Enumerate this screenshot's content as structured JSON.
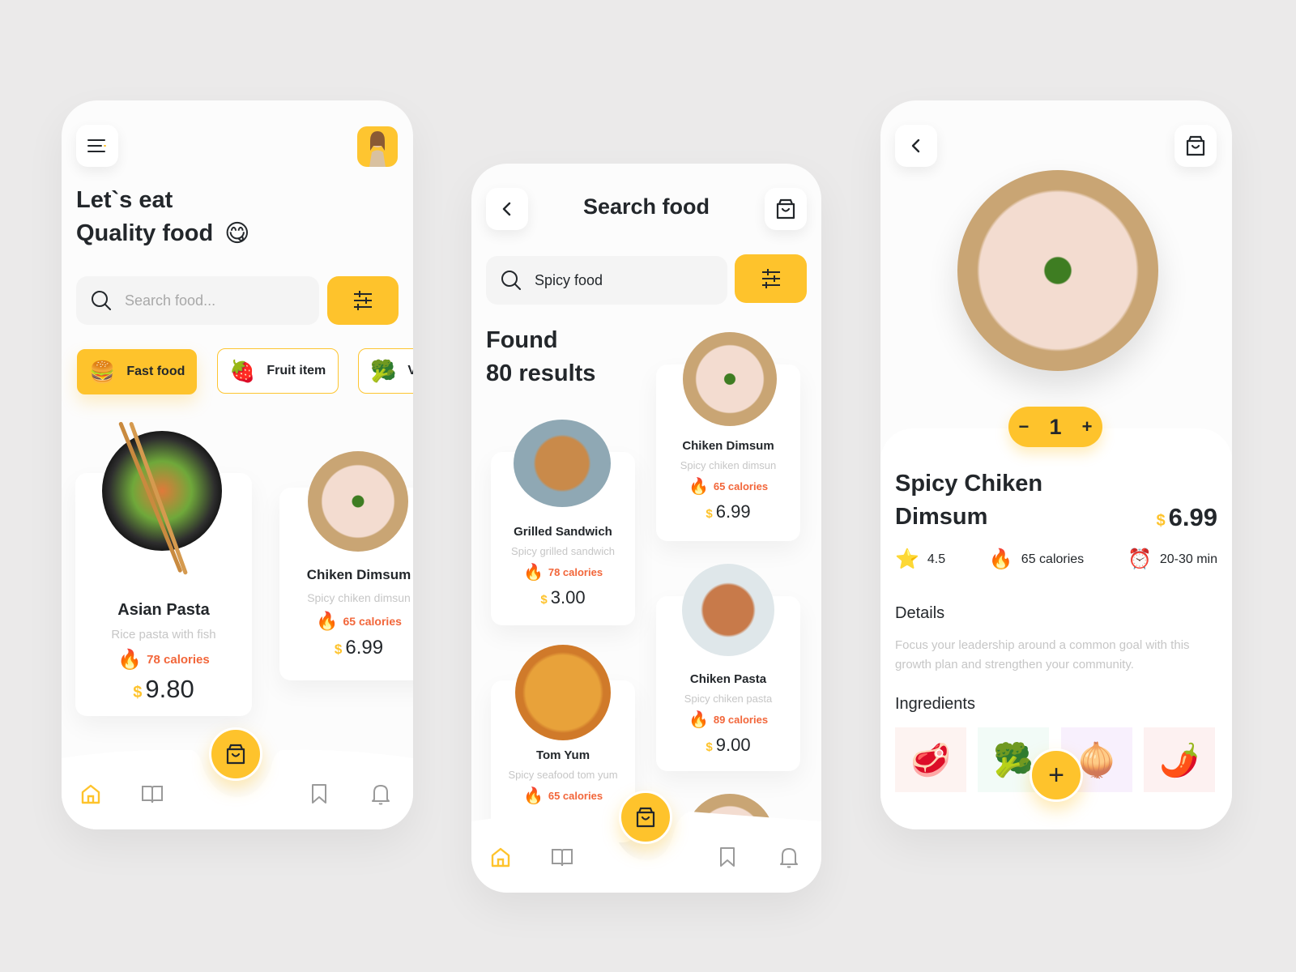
{
  "colors": {
    "accent": "#fec32c",
    "calorie": "#f2663a",
    "text": "#23272b",
    "muted": "#c6c6c6",
    "background": "#ebeaea"
  },
  "home": {
    "menu_icon": "hamburger-menu-icon",
    "avatar_icon": "user-avatar",
    "headline_line1": "Let`s eat",
    "headline_line2": "Quality food",
    "headline_emoji": "😋",
    "search_placeholder": "Search food...",
    "filter_icon": "sliders-icon",
    "categories": [
      {
        "label": "Fast food",
        "emoji": "🍔",
        "active": true
      },
      {
        "label": "Fruit item",
        "emoji": "🍓",
        "active": false
      },
      {
        "label": "V",
        "emoji": "🥦",
        "active": false
      }
    ],
    "cards": [
      {
        "name": "Asian Pasta",
        "desc": "Rice pasta with fish",
        "calories": "78 calories",
        "currency": "$",
        "price": "9.80"
      },
      {
        "name": "Chiken Dimsum",
        "desc": "Spicy chiken dimsun",
        "calories": "65 calories",
        "currency": "$",
        "price": "6.99"
      }
    ],
    "nav": [
      "home-icon",
      "book-icon",
      "cart-icon",
      "bookmark-icon",
      "bell-icon"
    ]
  },
  "search": {
    "title": "Search food",
    "search_value": "Spicy food",
    "found_line1": "Found",
    "found_line2": "80 results",
    "results": [
      {
        "name": "Grilled Sandwich",
        "desc": "Spicy grilled sandwich",
        "calories": "78 calories",
        "currency": "$",
        "price": "3.00"
      },
      {
        "name": "Chiken Dimsum",
        "desc": "Spicy chiken dimsun",
        "calories": "65 calories",
        "currency": "$",
        "price": "6.99"
      },
      {
        "name": "Tom Yum",
        "desc": "Spicy seafood tom yum",
        "calories": "65 calories",
        "currency": "$",
        "price": ""
      },
      {
        "name": "Chiken Pasta",
        "desc": "Spicy chiken pasta",
        "calories": "89 calories",
        "currency": "$",
        "price": "9.00"
      }
    ]
  },
  "detail": {
    "quantity": "1",
    "minus": "−",
    "plus": "+",
    "title_line1": "Spicy Chiken",
    "title_line2": "Dimsum",
    "currency": "$",
    "price": "6.99",
    "rating": "4.5",
    "calories": "65 calories",
    "time": "20-30 min",
    "details_heading": "Details",
    "details_text": "Focus your leadership around a common goal with this growth plan and strengthen your community.",
    "ingredients_heading": "Ingredients",
    "ingredients": [
      {
        "name": "meat",
        "emoji": "🥩",
        "bg": "#fdf3f1"
      },
      {
        "name": "broccoli",
        "emoji": "🥦",
        "bg": "#f2fbf7"
      },
      {
        "name": "onion",
        "emoji": "🧅",
        "bg": "#f8f0fd"
      },
      {
        "name": "chili",
        "emoji": "🌶️",
        "bg": "#fdf1f1"
      }
    ],
    "add_label": "+"
  }
}
